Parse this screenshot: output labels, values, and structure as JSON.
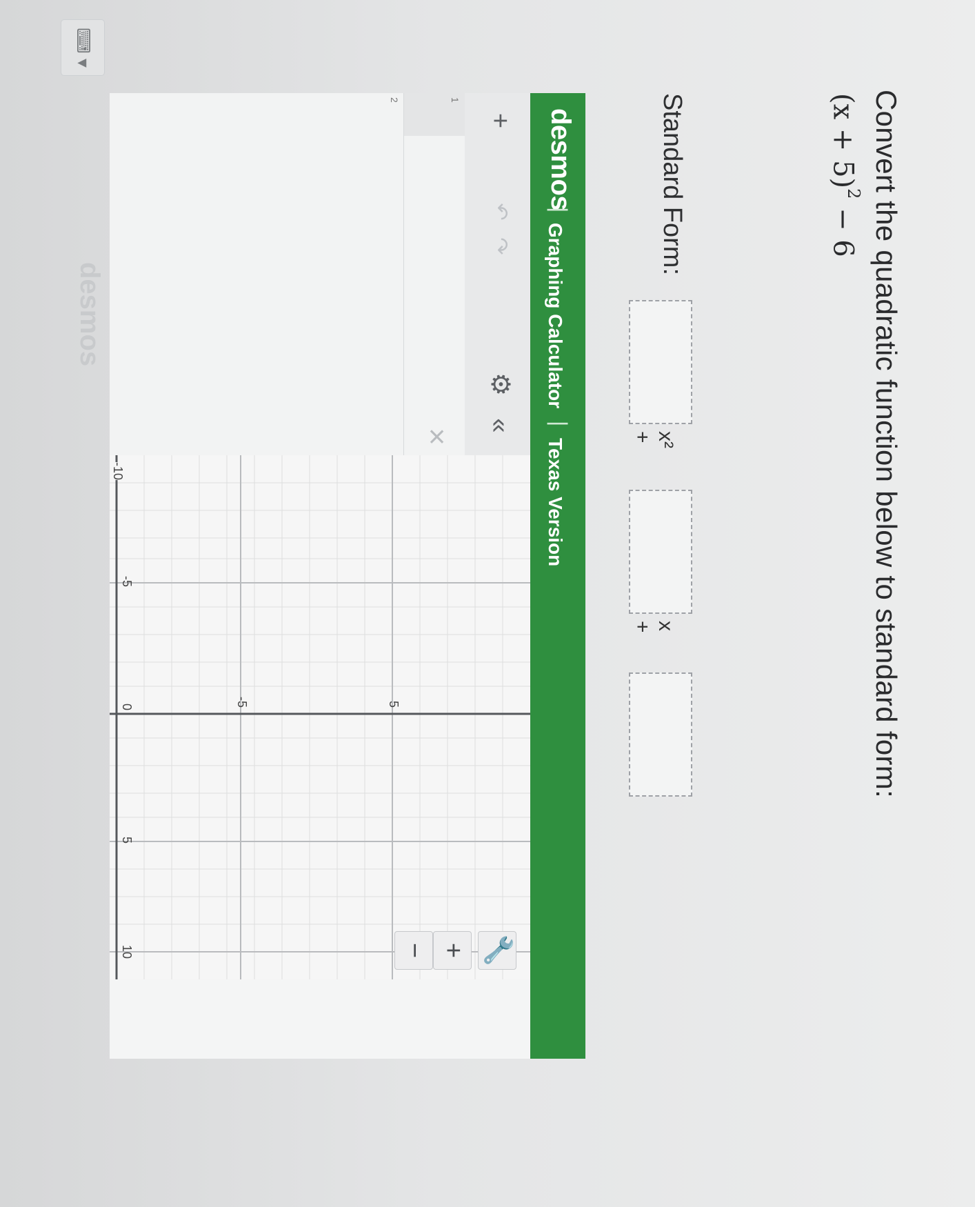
{
  "question": {
    "prompt": "Convert the quadratic function below to standard form:",
    "expression_base": "(x + 5)",
    "expression_exponent": "2",
    "expression_tail": " − 6"
  },
  "standard_form": {
    "label": "Standard Form:",
    "term_x2": "x² +",
    "term_x": "x +"
  },
  "desmos": {
    "brand": "desmos",
    "separator": "|",
    "title": "Graphing Calculator",
    "edition": "Texas Version",
    "toolbar": {
      "add": "+",
      "undo": "↶",
      "redo": "↷",
      "settings": "⚙",
      "collapse": "«"
    },
    "expressions": [
      {
        "index": "1"
      },
      {
        "index": "2"
      }
    ],
    "delete_glyph": "×",
    "graph": {
      "x_ticks": [
        "-10",
        "-5",
        "0",
        "5",
        "10"
      ],
      "y_ticks": [
        "5",
        "-5"
      ],
      "accent_color": "#2f8f3f"
    },
    "zoom": {
      "wrench": "🔧",
      "zoom_in": "+",
      "zoom_out": "−"
    },
    "footer_brand": "desmos",
    "keypad_icon": "keyboard-icon"
  }
}
